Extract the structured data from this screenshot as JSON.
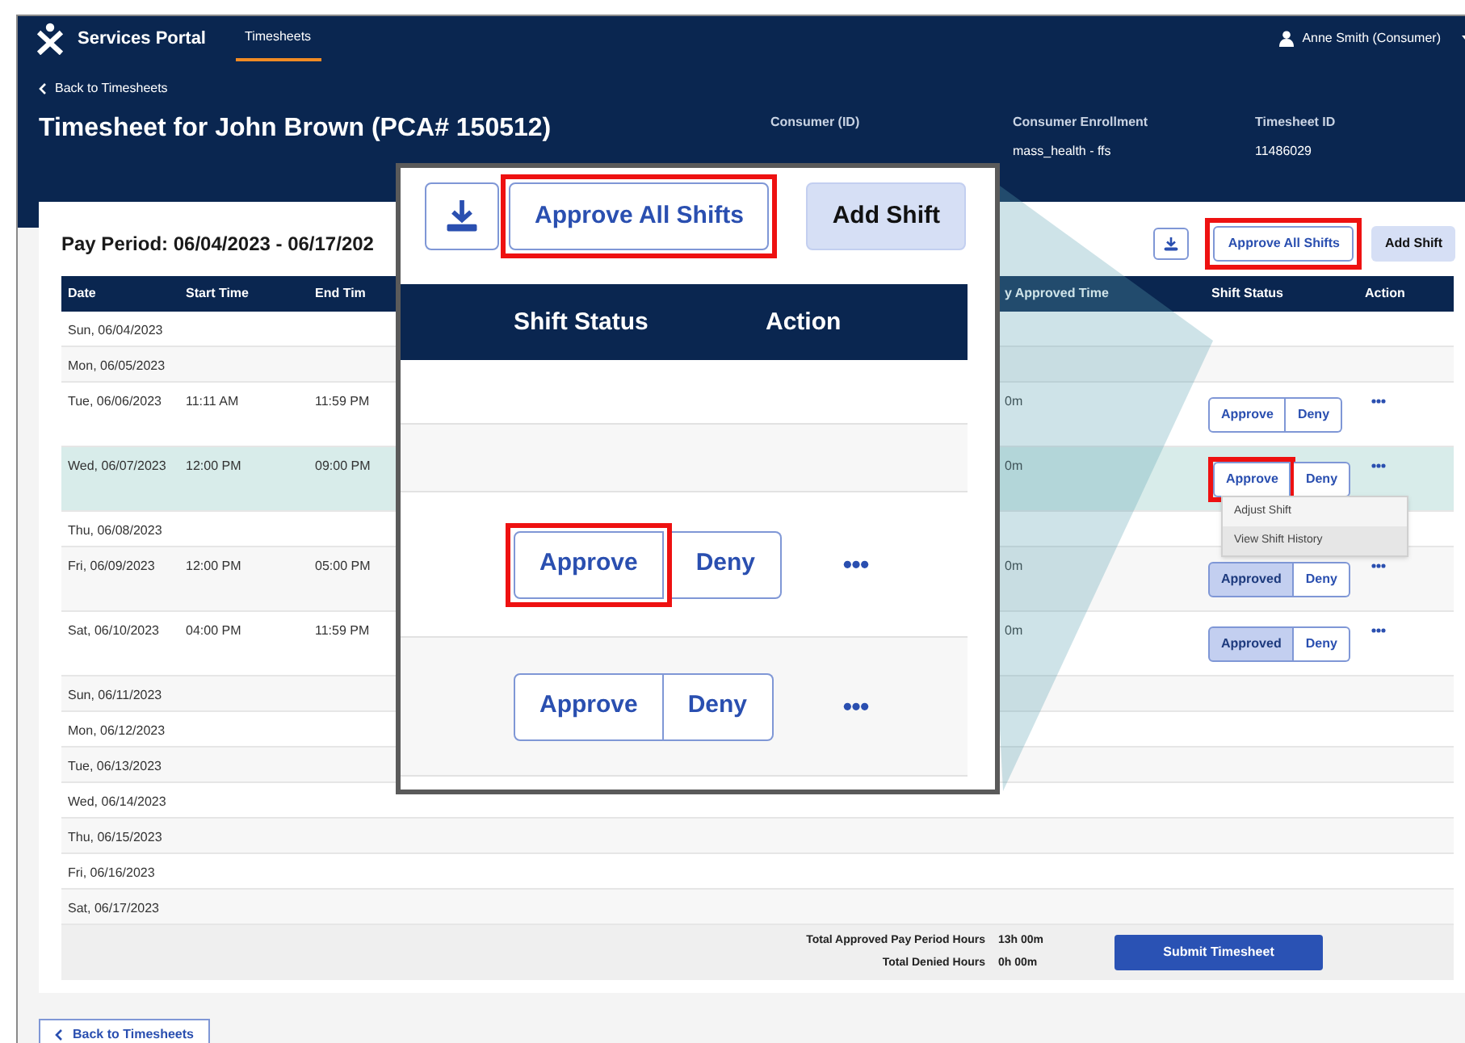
{
  "header": {
    "brand": "Services Portal",
    "nav": [
      {
        "label": "Timesheets",
        "selected": true
      }
    ],
    "user": "Anne Smith (Consumer)"
  },
  "back_link": "Back to Timesheets",
  "title": "Timesheet for John Brown (PCA# 150512)",
  "info": [
    {
      "label": "Consumer (ID)"
    },
    {
      "label": "Consumer Enrollment",
      "value": "mass_health - ffs"
    },
    {
      "label": "Timesheet ID",
      "value": "11486029"
    }
  ],
  "pay_period": "Pay Period: 06/04/2023 - 06/17/202",
  "toolbar": {
    "approve_all": {
      "label": "Approve All Shifts",
      "highlighted": true
    },
    "add_shift": "Add Shift"
  },
  "table": {
    "columns": [
      "Date",
      "Start Time",
      "End Tim",
      "y Approved Time",
      "Shift Status",
      "Action"
    ],
    "rows": [
      {
        "date": "Sun, 06/04/2023",
        "selected": false
      },
      {
        "date": "Mon, 06/05/2023",
        "selected": false
      },
      {
        "date": "Tue, 06/06/2023",
        "start": "11:11 AM",
        "end": "11:59 PM",
        "approved_time": "0m",
        "status": {
          "approve": "Approve",
          "deny": "Deny",
          "approved": false,
          "highlighted": false
        },
        "selected": false
      },
      {
        "date": "Wed, 06/07/2023",
        "start": "12:00 PM",
        "end": "09:00 PM",
        "approved_time": "0m",
        "status": {
          "approve": "Approve",
          "deny": "Deny",
          "approved": false,
          "highlighted": true
        },
        "selected": true,
        "menu": [
          {
            "label": "Adjust Shift",
            "hovered": false
          },
          {
            "label": "View Shift History",
            "hovered": true
          }
        ]
      },
      {
        "date": "Thu, 06/08/2023",
        "selected": false
      },
      {
        "date": "Fri, 06/09/2023",
        "start": "12:00 PM",
        "end": "05:00 PM",
        "approved_time": "0m",
        "status": {
          "approve": "Approved",
          "deny": "Deny",
          "approved": true,
          "highlighted": false
        },
        "selected": false
      },
      {
        "date": "Sat, 06/10/2023",
        "start": "04:00 PM",
        "end": "11:59 PM",
        "approved_time": "0m",
        "status": {
          "approve": "Approved",
          "deny": "Deny",
          "approved": true,
          "highlighted": false
        },
        "selected": false
      },
      {
        "date": "Sun, 06/11/2023",
        "selected": false
      },
      {
        "date": "Mon, 06/12/2023",
        "selected": false
      },
      {
        "date": "Tue, 06/13/2023",
        "selected": false
      },
      {
        "date": "Wed, 06/14/2023",
        "selected": false
      },
      {
        "date": "Thu, 06/15/2023",
        "selected": false
      },
      {
        "date": "Fri, 06/16/2023",
        "selected": false
      },
      {
        "date": "Sat, 06/17/2023",
        "selected": false
      }
    ]
  },
  "totals": [
    {
      "label": "Total Approved Pay Period Hours",
      "value": "13h 00m"
    },
    {
      "label": "Total Denied Hours",
      "value": "0h 00m"
    }
  ],
  "submit": "Submit Timesheet",
  "footer_back": "Back to Timesheets",
  "inset": {
    "approve_all": {
      "label": "Approve All Shifts",
      "highlighted": true
    },
    "add_shift": "Add Shift",
    "columns": [
      "Shift Status",
      "Action"
    ],
    "rows": [
      {
        "kind": "empty"
      },
      {
        "kind": "empty"
      },
      {
        "kind": "shift",
        "approve": "Approve",
        "deny": "Deny",
        "highlighted": true
      },
      {
        "kind": "shift",
        "approve": "Approve",
        "deny": "Deny",
        "highlighted": false
      }
    ]
  }
}
